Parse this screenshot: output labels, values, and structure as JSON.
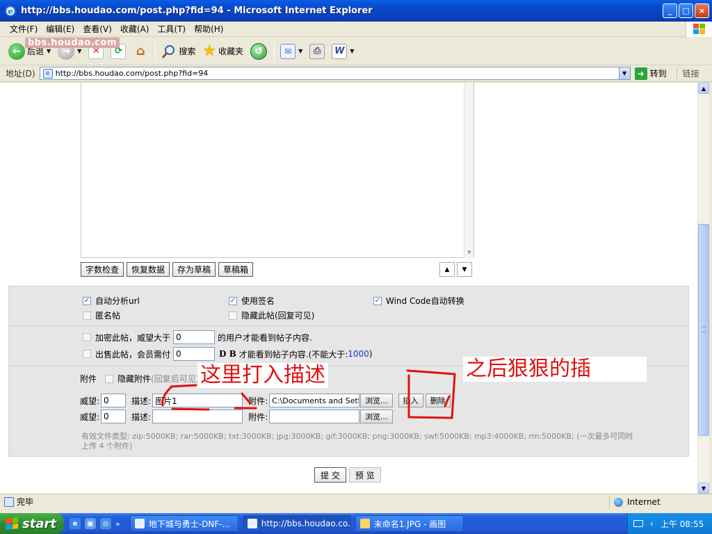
{
  "window": {
    "title": "http://bbs.houdao.com/post.php?fid=94 - Microsoft Internet Explorer",
    "controls": {
      "minimize": "_",
      "maximize": "□",
      "close": "×"
    }
  },
  "menu": [
    "文件(F)",
    "编辑(E)",
    "查看(V)",
    "收藏(A)",
    "工具(T)",
    "帮助(H)"
  ],
  "watermark": "bbs.houdao.com",
  "toolbar": {
    "back": "后退",
    "search": "搜索",
    "favorites": "收藏夹"
  },
  "address": {
    "label": "地址(D)",
    "url": "http://bbs.houdao.com/post.php?fid=94",
    "go": "转到",
    "links": "链接"
  },
  "editor": {
    "buttons": [
      "字数检查",
      "恢复数据",
      "存为草稿",
      "草稿箱"
    ],
    "expand": "▲",
    "shrink": "▼"
  },
  "options": {
    "auto_url": "自动分析url",
    "use_signature": "使用签名",
    "wind_code": "Wind Code自动转换",
    "anonymous": "匿名帖",
    "hide_post": "隐藏此帖(回复可见)",
    "encrypt_prefix": "加密此帖，威望大于",
    "encrypt_value": "0",
    "encrypt_suffix": "的用户才能看到帖子内容.",
    "sell_prefix": "出售此帖，会员需付",
    "sell_value": "0",
    "sell_suffix_db": "D B",
    "sell_suffix": "才能看到帖子内容.(不能大于:",
    "sell_max": "1000",
    "sell_close": ")"
  },
  "attachments": {
    "label": "附件",
    "hide_label": "隐藏附件",
    "hide_hint": "(回复后可见)",
    "rows": [
      {
        "prestige_label": "威望:",
        "prestige": "0",
        "desc_label": "描述:",
        "desc": "图片1",
        "file_label": "附件:",
        "file": "C:\\Documents and Sett",
        "browse": "浏览...",
        "insert": "插入",
        "delete": "删除"
      },
      {
        "prestige_label": "威望:",
        "prestige": "0",
        "desc_label": "描述:",
        "desc": "",
        "file_label": "附件:",
        "file": "",
        "browse": "浏览..."
      }
    ],
    "file_types": "有效文件类型: zip:5000KB; rar:5000KB; txt:3000KB; jpg:3000KB; gif:3000KB; png:3000KB; swf:5000KB; mp3:4000KB; rm:5000KB; (一次最多可同时上传 4 个附件)"
  },
  "submit": {
    "submit": "提 交",
    "preview": "预 览"
  },
  "annotations": {
    "type_description": "这里打入描述",
    "then_insert": "之后狠狠的插"
  },
  "status": {
    "text": "完毕",
    "zone": "Internet"
  },
  "taskbar": {
    "start": "start",
    "more": "»",
    "tasks": [
      "地下城与勇士-DNF-...",
      "http://bbs.houdao.co...",
      "未命名1.JPG - 画图"
    ],
    "tray_more": "‹",
    "clock": "上午 08:55"
  },
  "colors": {
    "annotation": "#e01010",
    "titlebar": "#0a46c8",
    "taskbar": "#245edb"
  }
}
